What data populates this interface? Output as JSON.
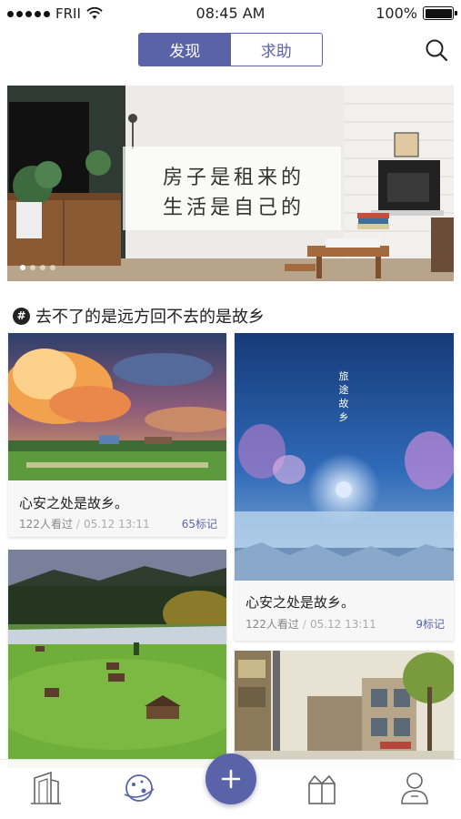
{
  "status_bar": {
    "carrier": "FRII",
    "time": "08:45 AM",
    "battery": "100%"
  },
  "header": {
    "tabs": [
      {
        "label": "发现",
        "active": true
      },
      {
        "label": "求助",
        "active": false
      }
    ],
    "search_icon": "search-icon"
  },
  "banner": {
    "line1": "房子是租来的",
    "line2": "生活是自己的",
    "page_count": 4,
    "active_page": 1
  },
  "topic": {
    "icon": "hash-icon",
    "title": "去不了的是远方回不去的是故乡"
  },
  "cards": [
    {
      "title": "心安之处是故乡。",
      "views": "122人看过",
      "separator": "/",
      "date": "05.12 13:11",
      "marks": "65标记"
    },
    {
      "poster_title": "旅途故乡",
      "title": "心安之处是故乡。",
      "views": "122人看过",
      "separator": "/",
      "date": "05.12 13:11",
      "marks": "9标记"
    }
  ],
  "tabbar": {
    "items": [
      "building-icon",
      "planet-icon",
      "add-icon",
      "gift-icon",
      "profile-icon"
    ]
  },
  "colors": {
    "accent": "#5a63a8",
    "text": "#222222",
    "meta": "#888888"
  }
}
